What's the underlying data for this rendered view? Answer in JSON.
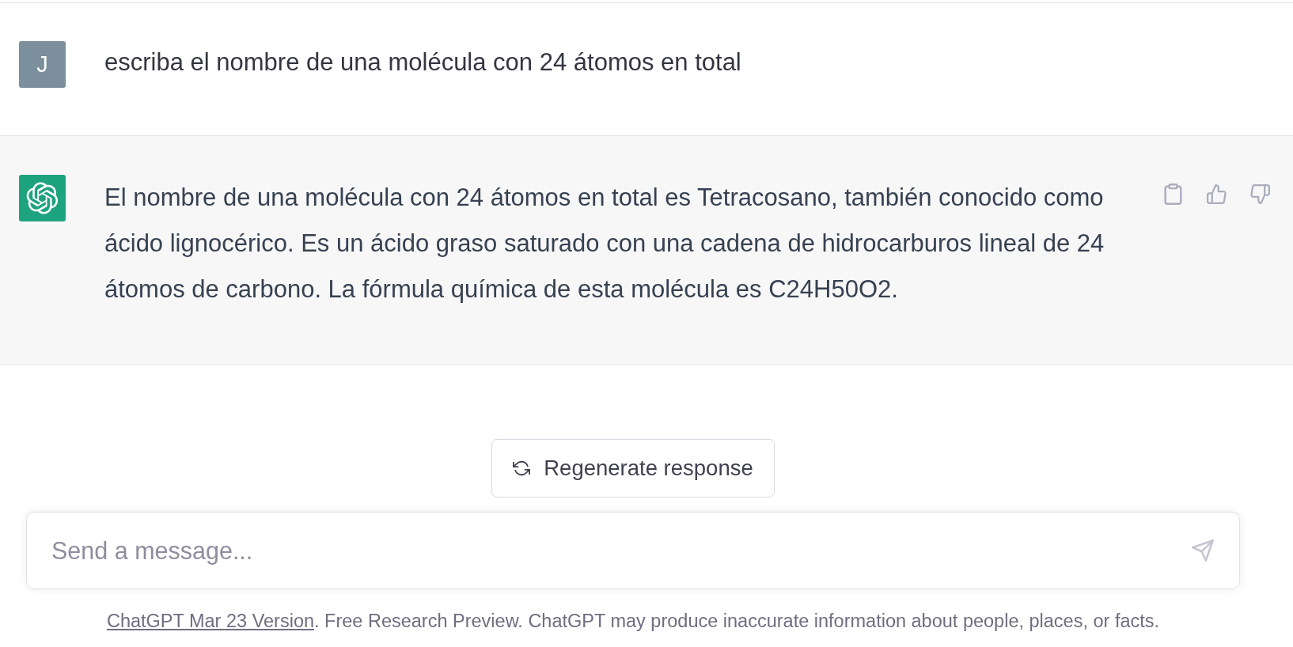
{
  "thread": [
    {
      "kind": "user",
      "avatar": "J",
      "text": "escriba el nombre de una molécula con 24 átomos en total"
    },
    {
      "kind": "assistant",
      "text": "El nombre de una molécula con 24 átomos en total es Tetracosano, también conocido como ácido lignocérico. Es un ácido graso saturado con una cadena de hidrocarburos lineal de 24 átomos de carbono. La fórmula química de esta molécula es C24H50O2."
    }
  ],
  "regenerate_button": {
    "label": "Regenerate response"
  },
  "composer": {
    "placeholder": "Send a message..."
  },
  "footer": {
    "link": "ChatGPT Mar 23 Version",
    "text": ". Free Research Preview. ChatGPT may produce inaccurate information about people, places, or facts."
  }
}
